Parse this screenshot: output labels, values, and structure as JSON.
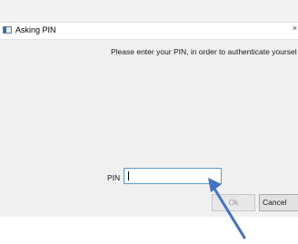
{
  "dialog": {
    "title": "Asking PIN",
    "close_glyph": "×",
    "message": "Please enter your PIN, in order to authenticate yoursel",
    "pin_label": "PIN",
    "pin_value": "",
    "ok_label": "Ok",
    "cancel_label": "Cancel",
    "ok_enabled": false
  },
  "annotation": {
    "arrow_color": "#4472c4"
  },
  "icons": {
    "app_icon": "window-icon",
    "arrow": "annotation-arrow"
  }
}
